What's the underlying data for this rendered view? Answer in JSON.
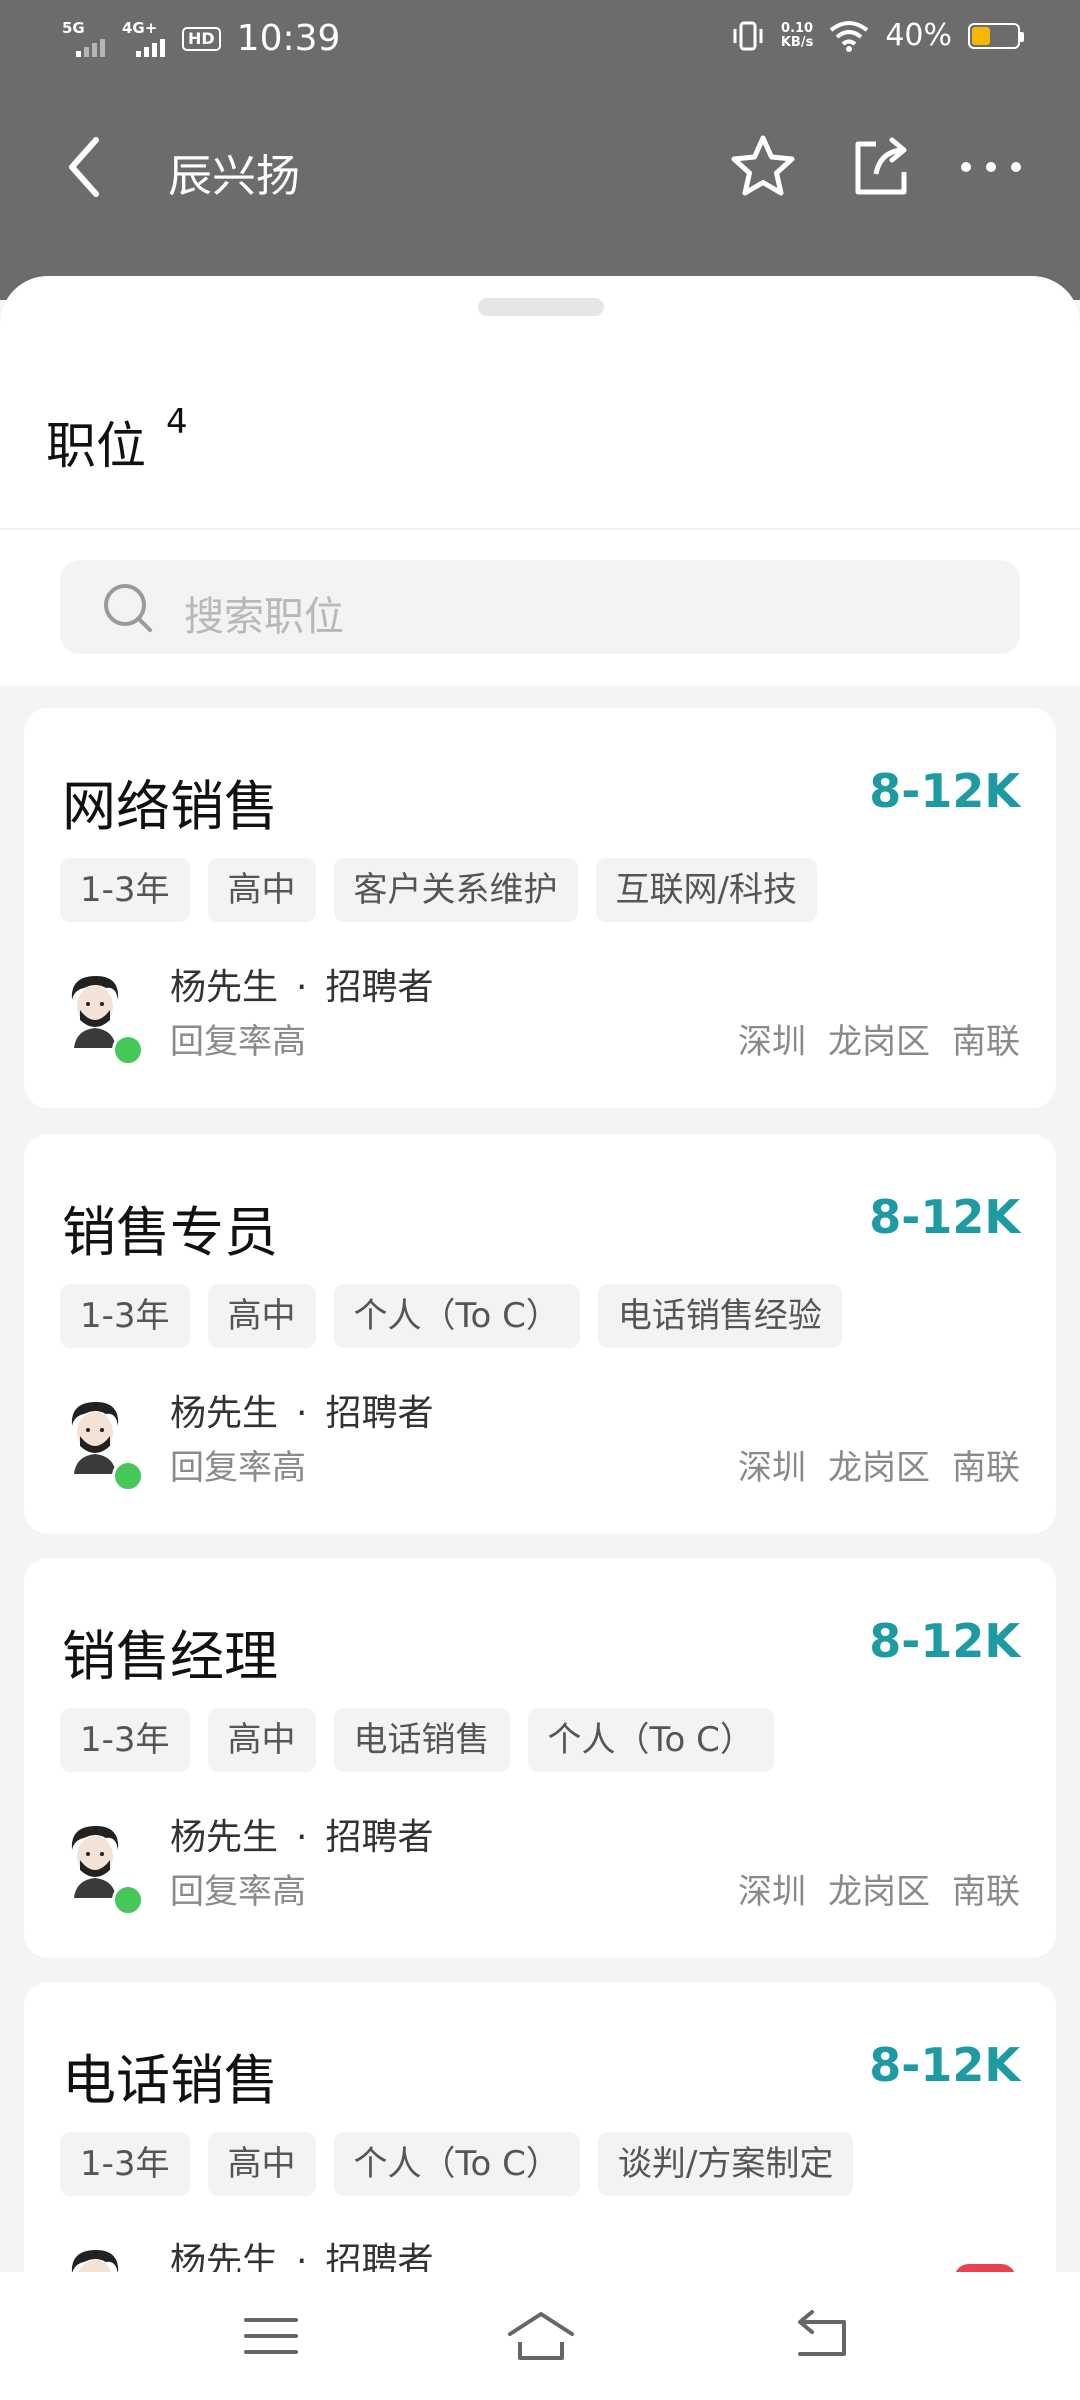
{
  "status": {
    "sig1": "5G",
    "sig2": "4G+",
    "hd": "HD",
    "time": "10:39",
    "net_value": "0.10",
    "net_unit": "KB/s",
    "battery": "40%",
    "battery_level": 0.4,
    "battery_color": "#f5b800"
  },
  "header": {
    "title": "辰兴扬",
    "icons": [
      "back-arrow-icon",
      "star-icon",
      "share-icon",
      "more-icon"
    ]
  },
  "section": {
    "title": "职位",
    "count": "4"
  },
  "search": {
    "placeholder": "搜索职位",
    "icon": "search-icon"
  },
  "jobs": [
    {
      "title": "网络销售",
      "salary": "8-12K",
      "tags": [
        "1-3年",
        "高中",
        "客户关系维护",
        "互联网/科技"
      ],
      "recruiter": "杨先生",
      "role": "招聘者",
      "reply": "回复率高",
      "city": "深圳",
      "district": "龙岗区",
      "area": "南联"
    },
    {
      "title": "销售专员",
      "salary": "8-12K",
      "tags": [
        "1-3年",
        "高中",
        "个人（To C）",
        "电话销售经验"
      ],
      "recruiter": "杨先生",
      "role": "招聘者",
      "reply": "回复率高",
      "city": "深圳",
      "district": "龙岗区",
      "area": "南联"
    },
    {
      "title": "销售经理",
      "salary": "8-12K",
      "tags": [
        "1-3年",
        "高中",
        "电话销售",
        "个人（To C）"
      ],
      "recruiter": "杨先生",
      "role": "招聘者",
      "reply": "回复率高",
      "city": "深圳",
      "district": "龙岗区",
      "area": "南联"
    },
    {
      "title": "电话销售",
      "salary": "8-12K",
      "tags": [
        "1-3年",
        "高中",
        "个人（To C）",
        "谈判/方案制定"
      ],
      "recruiter": "杨先生",
      "role": "招聘者",
      "reply": "",
      "city": "",
      "district": "",
      "area": ""
    }
  ],
  "colors": {
    "header_bg": "#6c6c6c",
    "salary": "#1e9aa2",
    "online": "#46c759",
    "badge": "#e8424f"
  },
  "bottom_nav": [
    "menu-icon",
    "home-icon",
    "back-icon"
  ]
}
